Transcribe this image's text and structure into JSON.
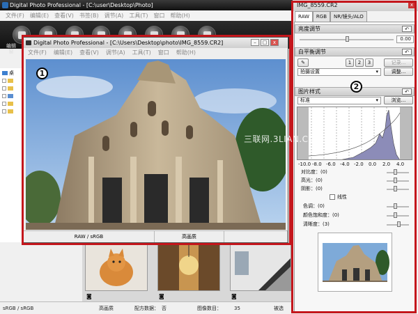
{
  "main": {
    "title": "Digital Photo Professional - [C:\\user\\Desktop\\Photo]",
    "menu": [
      "文件(F)",
      "编辑(E)",
      "查看(V)",
      "书签(B)",
      "调节(A)",
      "工具(T)",
      "窗口",
      "帮助(H)"
    ],
    "toolbar_label": "编辑\n窗",
    "tree_label": "桌",
    "status": {
      "color_space": "sRGB / sRGB",
      "quality": "高画质",
      "recipe": "配方数据：",
      "recipe_value": "否",
      "count_label": "图像数目：",
      "count_value": "35",
      "selected": "被选"
    }
  },
  "inner": {
    "title": "Digital Photo Professional - [C:\\Users\\Desktop\\photo\\IMG_8559.CR2]",
    "menu": [
      "文件(F)",
      "编辑(E)",
      "查看(V)",
      "调节(A)",
      "工具(T)",
      "窗口",
      "帮助(H)"
    ],
    "status_left": "RAW / sRGB",
    "status_mid": "高画质",
    "badge": "1"
  },
  "panel": {
    "title": "IMG_8559.CR2",
    "close": "x",
    "tabs": [
      "RAW",
      "RGB",
      "NR/镜头/ALO"
    ],
    "brightness": {
      "label": "亮度调节",
      "value": "0.00",
      "reset": "↶"
    },
    "wb": {
      "label": "白平衡调节",
      "reset": "↶",
      "pick_icon": "eyedropper-icon",
      "presets": [
        "1",
        "2",
        "3"
      ],
      "register": "记录...",
      "mode": "拍摄设置",
      "adjust": "调整..."
    },
    "style": {
      "label": "图片样式",
      "reset": "↶",
      "value": "标准",
      "browse": "浏览..."
    },
    "histogram_ticks": [
      "-10.0",
      "-8.0",
      "-6.0",
      "-4.0",
      "-2.0",
      "0.0",
      "2.0",
      "4.0"
    ],
    "sliders": {
      "contrast": "对比度：(0)",
      "highlight": "高光：(0)",
      "shadow": "阴影：(0)",
      "linear": "线性",
      "tone": "色调：(0)",
      "saturation": "颜色饱和度：(0)",
      "sharpness": "清晰度：(3)"
    },
    "badge": "2"
  },
  "watermark": "三联网.3LIAN.COM",
  "colors": {
    "highlight_border": "#c4161c",
    "toolbar": "#1a1a1a",
    "sky": "#8fb7e0"
  }
}
